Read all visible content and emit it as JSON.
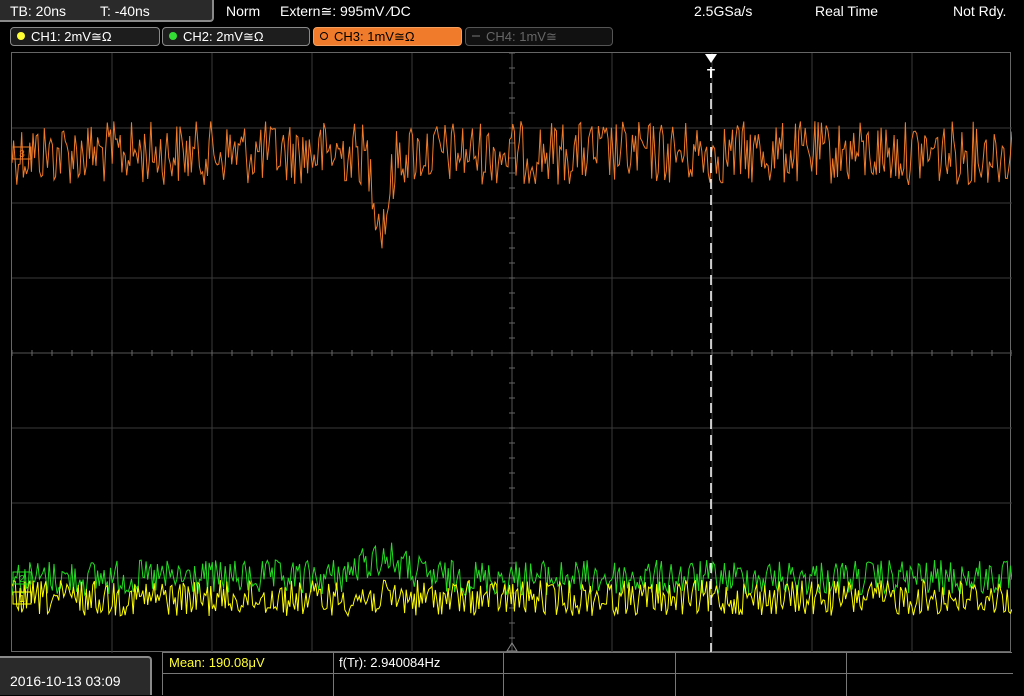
{
  "topbar": {
    "timebase": "TB: 20ns",
    "trigger_time": "T: -40ns",
    "trigger_mode": "Norm",
    "trigger_source": "Extern≅: 995mV ⁄DC",
    "sample_rate": "2.5GSa/s",
    "acq_mode": "Real Time",
    "status": "Not Rdy."
  },
  "channels": [
    {
      "label": "CH1: 2mV≅Ω",
      "color": "#ffff33",
      "state": "on"
    },
    {
      "label": "CH2: 2mV≅Ω",
      "color": "#33dd33",
      "state": "on"
    },
    {
      "label": "CH3: 1mV≅Ω",
      "color": "#f07b2a",
      "state": "active"
    },
    {
      "label": "CH4: 1mV≅",
      "color": "#666666",
      "state": "off"
    }
  ],
  "trace_colors": {
    "ch1": "#ffff00",
    "ch2": "#22dd22",
    "ch3": "#f07b2a"
  },
  "trigger_marker": "T",
  "markers": {
    "ch1": "1",
    "ch2": "2",
    "ch3": "3"
  },
  "date": "2016-10-13 03:09",
  "measurements": {
    "mean": "Mean: 190.08μV",
    "freq": "f(Tr): 2.940084Hz"
  }
}
